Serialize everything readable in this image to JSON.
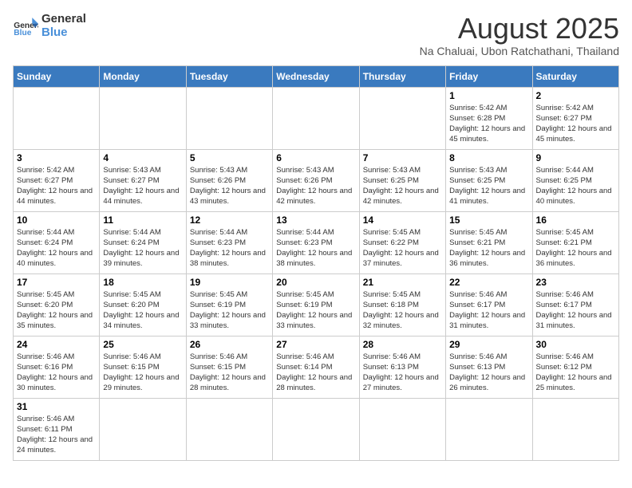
{
  "header": {
    "logo_general": "General",
    "logo_blue": "Blue",
    "title": "August 2025",
    "subtitle": "Na Chaluai, Ubon Ratchathani, Thailand"
  },
  "weekdays": [
    "Sunday",
    "Monday",
    "Tuesday",
    "Wednesday",
    "Thursday",
    "Friday",
    "Saturday"
  ],
  "weeks": [
    [
      {
        "day": "",
        "info": ""
      },
      {
        "day": "",
        "info": ""
      },
      {
        "day": "",
        "info": ""
      },
      {
        "day": "",
        "info": ""
      },
      {
        "day": "",
        "info": ""
      },
      {
        "day": "1",
        "info": "Sunrise: 5:42 AM\nSunset: 6:28 PM\nDaylight: 12 hours and 45 minutes."
      },
      {
        "day": "2",
        "info": "Sunrise: 5:42 AM\nSunset: 6:27 PM\nDaylight: 12 hours and 45 minutes."
      }
    ],
    [
      {
        "day": "3",
        "info": "Sunrise: 5:42 AM\nSunset: 6:27 PM\nDaylight: 12 hours and 44 minutes."
      },
      {
        "day": "4",
        "info": "Sunrise: 5:43 AM\nSunset: 6:27 PM\nDaylight: 12 hours and 44 minutes."
      },
      {
        "day": "5",
        "info": "Sunrise: 5:43 AM\nSunset: 6:26 PM\nDaylight: 12 hours and 43 minutes."
      },
      {
        "day": "6",
        "info": "Sunrise: 5:43 AM\nSunset: 6:26 PM\nDaylight: 12 hours and 42 minutes."
      },
      {
        "day": "7",
        "info": "Sunrise: 5:43 AM\nSunset: 6:25 PM\nDaylight: 12 hours and 42 minutes."
      },
      {
        "day": "8",
        "info": "Sunrise: 5:43 AM\nSunset: 6:25 PM\nDaylight: 12 hours and 41 minutes."
      },
      {
        "day": "9",
        "info": "Sunrise: 5:44 AM\nSunset: 6:25 PM\nDaylight: 12 hours and 40 minutes."
      }
    ],
    [
      {
        "day": "10",
        "info": "Sunrise: 5:44 AM\nSunset: 6:24 PM\nDaylight: 12 hours and 40 minutes."
      },
      {
        "day": "11",
        "info": "Sunrise: 5:44 AM\nSunset: 6:24 PM\nDaylight: 12 hours and 39 minutes."
      },
      {
        "day": "12",
        "info": "Sunrise: 5:44 AM\nSunset: 6:23 PM\nDaylight: 12 hours and 38 minutes."
      },
      {
        "day": "13",
        "info": "Sunrise: 5:44 AM\nSunset: 6:23 PM\nDaylight: 12 hours and 38 minutes."
      },
      {
        "day": "14",
        "info": "Sunrise: 5:45 AM\nSunset: 6:22 PM\nDaylight: 12 hours and 37 minutes."
      },
      {
        "day": "15",
        "info": "Sunrise: 5:45 AM\nSunset: 6:21 PM\nDaylight: 12 hours and 36 minutes."
      },
      {
        "day": "16",
        "info": "Sunrise: 5:45 AM\nSunset: 6:21 PM\nDaylight: 12 hours and 36 minutes."
      }
    ],
    [
      {
        "day": "17",
        "info": "Sunrise: 5:45 AM\nSunset: 6:20 PM\nDaylight: 12 hours and 35 minutes."
      },
      {
        "day": "18",
        "info": "Sunrise: 5:45 AM\nSunset: 6:20 PM\nDaylight: 12 hours and 34 minutes."
      },
      {
        "day": "19",
        "info": "Sunrise: 5:45 AM\nSunset: 6:19 PM\nDaylight: 12 hours and 33 minutes."
      },
      {
        "day": "20",
        "info": "Sunrise: 5:45 AM\nSunset: 6:19 PM\nDaylight: 12 hours and 33 minutes."
      },
      {
        "day": "21",
        "info": "Sunrise: 5:45 AM\nSunset: 6:18 PM\nDaylight: 12 hours and 32 minutes."
      },
      {
        "day": "22",
        "info": "Sunrise: 5:46 AM\nSunset: 6:17 PM\nDaylight: 12 hours and 31 minutes."
      },
      {
        "day": "23",
        "info": "Sunrise: 5:46 AM\nSunset: 6:17 PM\nDaylight: 12 hours and 31 minutes."
      }
    ],
    [
      {
        "day": "24",
        "info": "Sunrise: 5:46 AM\nSunset: 6:16 PM\nDaylight: 12 hours and 30 minutes."
      },
      {
        "day": "25",
        "info": "Sunrise: 5:46 AM\nSunset: 6:15 PM\nDaylight: 12 hours and 29 minutes."
      },
      {
        "day": "26",
        "info": "Sunrise: 5:46 AM\nSunset: 6:15 PM\nDaylight: 12 hours and 28 minutes."
      },
      {
        "day": "27",
        "info": "Sunrise: 5:46 AM\nSunset: 6:14 PM\nDaylight: 12 hours and 28 minutes."
      },
      {
        "day": "28",
        "info": "Sunrise: 5:46 AM\nSunset: 6:13 PM\nDaylight: 12 hours and 27 minutes."
      },
      {
        "day": "29",
        "info": "Sunrise: 5:46 AM\nSunset: 6:13 PM\nDaylight: 12 hours and 26 minutes."
      },
      {
        "day": "30",
        "info": "Sunrise: 5:46 AM\nSunset: 6:12 PM\nDaylight: 12 hours and 25 minutes."
      }
    ],
    [
      {
        "day": "31",
        "info": "Sunrise: 5:46 AM\nSunset: 6:11 PM\nDaylight: 12 hours and 24 minutes."
      },
      {
        "day": "",
        "info": ""
      },
      {
        "day": "",
        "info": ""
      },
      {
        "day": "",
        "info": ""
      },
      {
        "day": "",
        "info": ""
      },
      {
        "day": "",
        "info": ""
      },
      {
        "day": "",
        "info": ""
      }
    ]
  ]
}
